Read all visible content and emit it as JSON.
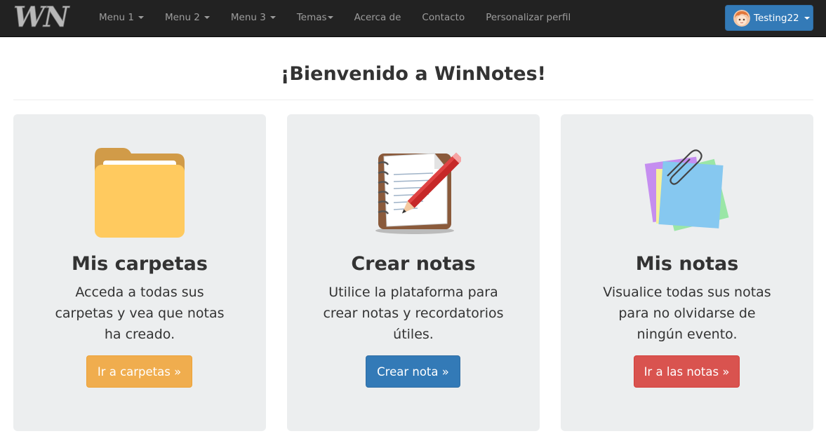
{
  "navbar": {
    "brand_text": "WN",
    "items": [
      {
        "label": "Menu 1",
        "dropdown": true
      },
      {
        "label": "Menu 2",
        "dropdown": true
      },
      {
        "label": "Menu 3",
        "dropdown": true
      },
      {
        "label": "Temas",
        "dropdown": true
      },
      {
        "label": "Acerca de",
        "dropdown": false
      },
      {
        "label": "Contacto",
        "dropdown": false
      },
      {
        "label": "Personalizar perfil",
        "dropdown": false
      }
    ],
    "user": {
      "name": "Testing22",
      "avatar_icon": "anime-avatar-icon"
    }
  },
  "header": {
    "title": "¡Bienvenido a WinNotes!"
  },
  "cards": [
    {
      "icon": "folder-icon",
      "title": "Mis carpetas",
      "text": "Acceda a todas sus carpetas y vea que notas ha creado.",
      "button": "Ir a carpetas »",
      "button_color": "#f0ad4e"
    },
    {
      "icon": "notebook-pencil-icon",
      "title": "Crear notas",
      "text": "Utilice la plataforma para crear notas y recordatorios útiles.",
      "button": "Crear nota »",
      "button_color": "#337ab7"
    },
    {
      "icon": "sticky-notes-icon",
      "title": "Mis notas",
      "text": "Visualice todas sus notas para no olvidarse de ningún evento.",
      "button": "Ir a las notas »",
      "button_color": "#d9534f"
    }
  ],
  "colors": {
    "navbar_bg": "#222222",
    "nav_text": "#9d9d9d",
    "card_bg": "#eceeef"
  }
}
